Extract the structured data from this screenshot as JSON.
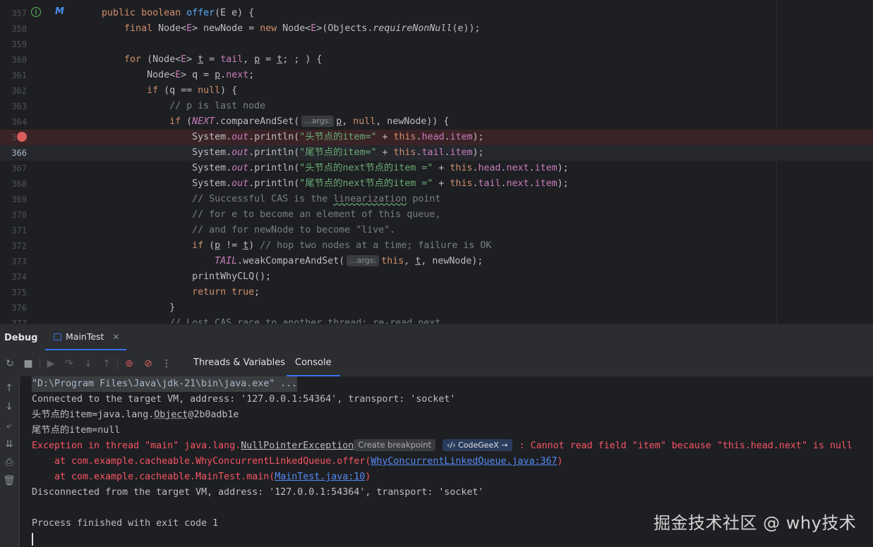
{
  "editor": {
    "lines": [
      {
        "num": "357",
        "html": "    <span class=\"kw\">public boolean</span> <span class=\"fn\">offer</span>(E e) {"
      },
      {
        "num": "358",
        "html": "        <span class=\"kw\">final</span> Node&lt;<span class=\"fld\">E</span>&gt; newNode = <span class=\"kw\">new</span> Node&lt;<span class=\"fld\">E</span>&gt;(Objects.<span class=\"it\">requireNonNull</span>(e));"
      },
      {
        "num": "359",
        "html": ""
      },
      {
        "num": "360",
        "html": "        <span class=\"kw\">for</span> (Node&lt;<span class=\"fld\">E</span>&gt; <span class=\"ul\">t</span> = <span class=\"fld\">tail</span>, <span class=\"ul\">p</span> = <span class=\"ul\">t</span>; ; ) {"
      },
      {
        "num": "361",
        "html": "            Node&lt;<span class=\"fld\">E</span>&gt; q = <span class=\"ul\">p</span>.<span class=\"fld\">next</span>;"
      },
      {
        "num": "362",
        "html": "            <span class=\"kw\">if</span> (q == <span class=\"kw\">null</span>) {"
      },
      {
        "num": "363",
        "html": "                <span class=\"cm\">// p is last node</span>"
      },
      {
        "num": "364",
        "html": "                <span class=\"kw\">if</span> (<span class=\"st-fld\">NEXT</span>.compareAndSet(<span class=\"hint\">...args:</span><span class=\"ul\">p</span>, <span class=\"kw\">null</span>, newNode)) {"
      },
      {
        "num": "365",
        "html": "                    System.<span class=\"st-fld\">out</span>.println(<span class=\"st\">\"头节点的item=\"</span> + <span class=\"kw\">this</span>.<span class=\"fld\">head</span>.<span class=\"fld\">item</span>);"
      },
      {
        "num": "366",
        "html": "                    System.<span class=\"st-fld\">out</span>.println(<span class=\"st\">\"尾节点的item=\"</span> + <span class=\"kw\">this</span>.<span class=\"fld\">tail</span>.<span class=\"fld\">item</span>);"
      },
      {
        "num": "367",
        "html": "                    System.<span class=\"st-fld\">out</span>.println(<span class=\"st\">\"头节点的next节点的item =\"</span> + <span class=\"kw\">this</span>.<span class=\"fld\">head</span>.<span class=\"fld\">next</span>.<span class=\"fld\">item</span>);"
      },
      {
        "num": "368",
        "html": "                    System.<span class=\"st-fld\">out</span>.println(<span class=\"st\">\"尾节点的next节点的item =\"</span> + <span class=\"kw\">this</span>.<span class=\"fld\">tail</span>.<span class=\"fld\">next</span>.<span class=\"fld\">item</span>);"
      },
      {
        "num": "369",
        "html": "                    <span class=\"cm\">// Successful CAS is the <span class=\"wavy\">linearization</span> point</span>"
      },
      {
        "num": "370",
        "html": "                    <span class=\"cm\">// for e to become an element of this queue,</span>"
      },
      {
        "num": "371",
        "html": "                    <span class=\"cm\">// and for newNode to become \"live\".</span>"
      },
      {
        "num": "372",
        "html": "                    <span class=\"kw\">if</span> (<span class=\"ul\">p</span> != <span class=\"ul\">t</span>) <span class=\"cm\">// hop two nodes at a time; failure is OK</span>"
      },
      {
        "num": "373",
        "html": "                        <span class=\"st-fld\">TAIL</span>.weakCompareAndSet(<span class=\"hint\">...args:</span><span class=\"kw\">this</span>, <span class=\"ul\">t</span>, newNode);"
      },
      {
        "num": "374",
        "html": "                    printWhyCLQ();"
      },
      {
        "num": "375",
        "html": "                    <span class=\"kw\">return true</span>;"
      },
      {
        "num": "376",
        "html": "                }"
      },
      {
        "num": "377",
        "html": "                <span class=\"cm\">// Lost CAS race to another thread; re-read next</span>"
      }
    ]
  },
  "debug": {
    "title": "Debug",
    "session_tab": "MainTest",
    "tabs": {
      "threads": "Threads & Variables",
      "console": "Console"
    }
  },
  "console": {
    "lines": [
      {
        "cls": "con-cmd",
        "html": "\"D:\\Program Files\\Java\\jdk-21\\bin\\java.exe\" ..."
      },
      {
        "cls": "",
        "html": "Connected to the target VM, address: '127.0.0.1:54364', transport: 'socket'"
      },
      {
        "cls": "",
        "html": "头节点的item=java.lang.<span style=\"text-decoration:underline dotted\">Object</span>@2b0adb1e"
      },
      {
        "cls": "",
        "html": "尾节点的item=null"
      },
      {
        "cls": "con-err",
        "html": "Exception in thread \"main\" java.lang.<span style=\"text-decoration:underline;color:#bcbec4\">NullPointerException</span><span class=\"create-bp\">Create breakpoint</span><span class=\"codegeex\">‹/› CodeGeeX →</span>: Cannot read field \"item\" because \"this.head.next\" is null"
      },
      {
        "cls": "con-err",
        "html": "    at com.example.cacheable.WhyConcurrentLinkedQueue.offer(<span class=\"link\">WhyConcurrentLinkedQueue.java:367</span>)"
      },
      {
        "cls": "con-err",
        "html": "    at com.example.cacheable.MainTest.main(<span class=\"link\">MainTest.java:10</span>)"
      },
      {
        "cls": "",
        "html": "Disconnected from the target VM, address: '127.0.0.1:54364', transport: 'socket'"
      },
      {
        "cls": "",
        "html": ""
      },
      {
        "cls": "",
        "html": "Process finished with exit code 1"
      }
    ]
  },
  "watermark": "掘金技术社区 @ why技术",
  "colors": {
    "accent": "#3574f0",
    "error": "#f75464",
    "breakpoint": "#db5c5c"
  }
}
